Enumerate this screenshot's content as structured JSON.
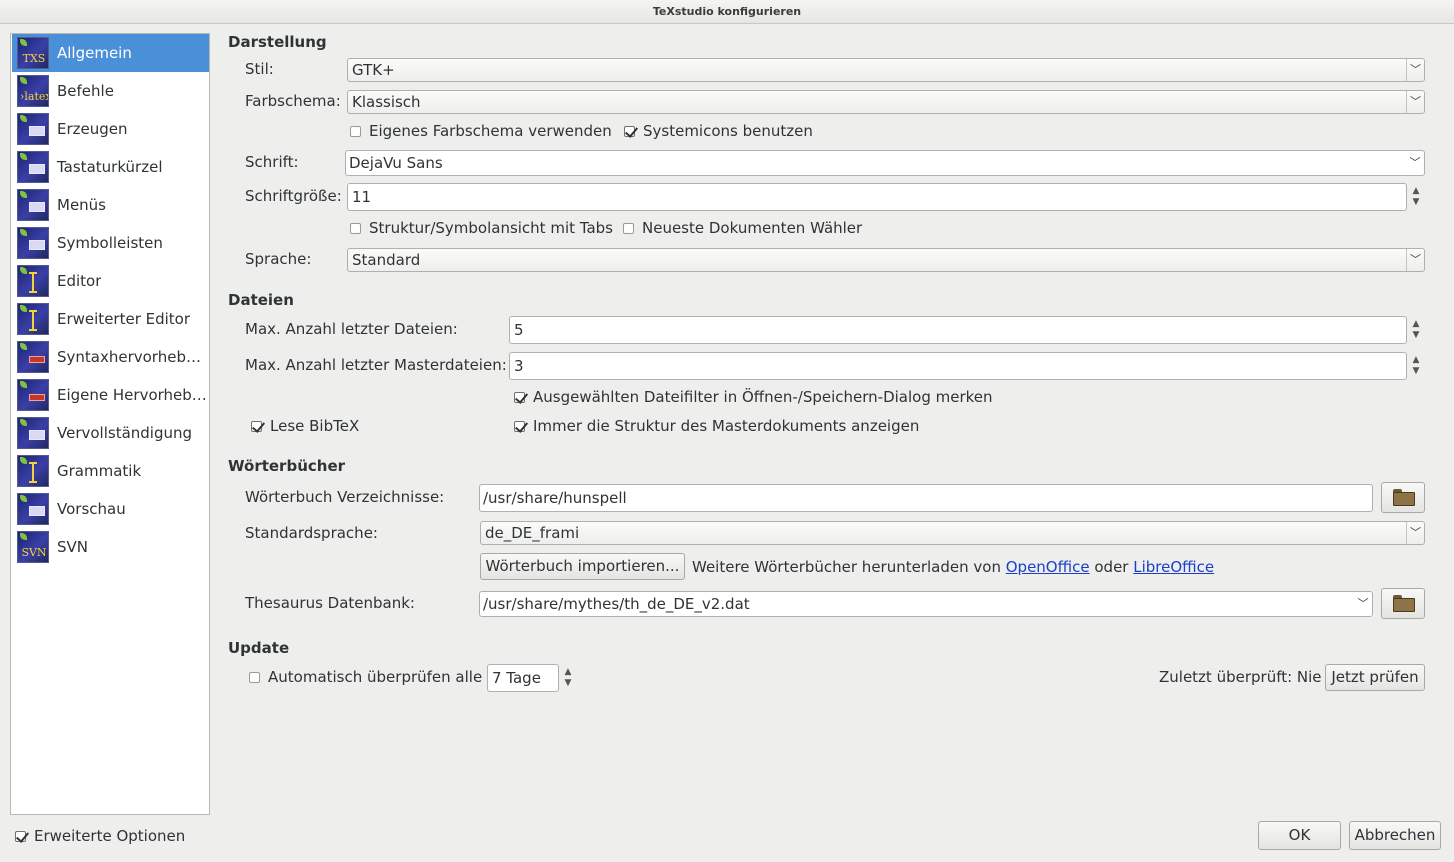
{
  "window": {
    "title": "TeXstudio konfigurieren"
  },
  "sidebar": {
    "items": [
      {
        "label": "Allgemein",
        "icon": "txs-icon",
        "selected": true
      },
      {
        "label": "Befehle",
        "icon": "latex-icon"
      },
      {
        "label": "Erzeugen",
        "icon": "build-icon"
      },
      {
        "label": "Tastaturkürzel",
        "icon": "keyboard-icon"
      },
      {
        "label": "Menüs",
        "icon": "menu-icon"
      },
      {
        "label": "Symbolleisten",
        "icon": "toolbar-icon"
      },
      {
        "label": "Editor",
        "icon": "editor-icon"
      },
      {
        "label": "Erweiterter Editor",
        "icon": "advanced-editor-icon"
      },
      {
        "label": "Syntaxhervorheb…",
        "icon": "syntax-highlight-icon"
      },
      {
        "label": "Eigene Hervorheb…",
        "icon": "custom-highlight-icon"
      },
      {
        "label": "Vervollständigung",
        "icon": "completion-icon"
      },
      {
        "label": "Grammatik",
        "icon": "grammar-icon"
      },
      {
        "label": "Vorschau",
        "icon": "preview-icon"
      },
      {
        "label": "SVN",
        "icon": "svn-icon"
      }
    ]
  },
  "darstellung": {
    "heading": "Darstellung",
    "stil_label": "Stil:",
    "stil_value": "GTK+",
    "farbschema_label": "Farbschema:",
    "farbschema_value": "Klassisch",
    "eigenes_farbschema": "Eigenes Farbschema verwenden",
    "systemicons": "Systemicons benutzen",
    "schrift_label": "Schrift:",
    "schrift_value": "DejaVu Sans",
    "schriftgroesse_label": "Schriftgröße:",
    "schriftgroesse_value": "11",
    "struktur_tabs": "Struktur/Symbolansicht mit Tabs",
    "neueste_dokumente": "Neueste Dokumenten Wähler",
    "sprache_label": "Sprache:",
    "sprache_value": "Standard"
  },
  "dateien": {
    "heading": "Dateien",
    "max_dateien_label": "Max. Anzahl letzter Dateien:",
    "max_dateien_value": "5",
    "max_master_label": "Max. Anzahl letzter Masterdateien:",
    "max_master_value": "3",
    "dateifilter": "Ausgewählten Dateifilter in Öffnen-/Speichern-Dialog merken",
    "lese_bibtex": "Lese BibTeX",
    "struktur_master": "Immer die Struktur des Masterdokuments anzeigen"
  },
  "woerterbuecher": {
    "heading": "Wörterbücher",
    "verzeichnisse_label": "Wörterbuch Verzeichnisse:",
    "verzeichnisse_value": "/usr/share/hunspell",
    "standardsprache_label": "Standardsprache:",
    "standardsprache_value": "de_DE_frami",
    "import_button": "Wörterbuch importieren...",
    "download_text": "Weitere Wörterbücher herunterladen von",
    "openoffice_link": "OpenOffice",
    "oder": "oder",
    "libreoffice_link": "LibreOffice",
    "thesaurus_label": "Thesaurus Datenbank:",
    "thesaurus_value": "/usr/share/mythes/th_de_DE_v2.dat"
  },
  "update": {
    "heading": "Update",
    "auto_check": "Automatisch überprüfen alle",
    "interval_value": "7 Tage",
    "zuletzt": "Zuletzt überprüft: Nie",
    "jetzt_button": "Jetzt prüfen"
  },
  "footer": {
    "erweiterte_optionen": "Erweiterte Optionen",
    "ok": "OK",
    "abbrechen": "Abbrechen"
  }
}
